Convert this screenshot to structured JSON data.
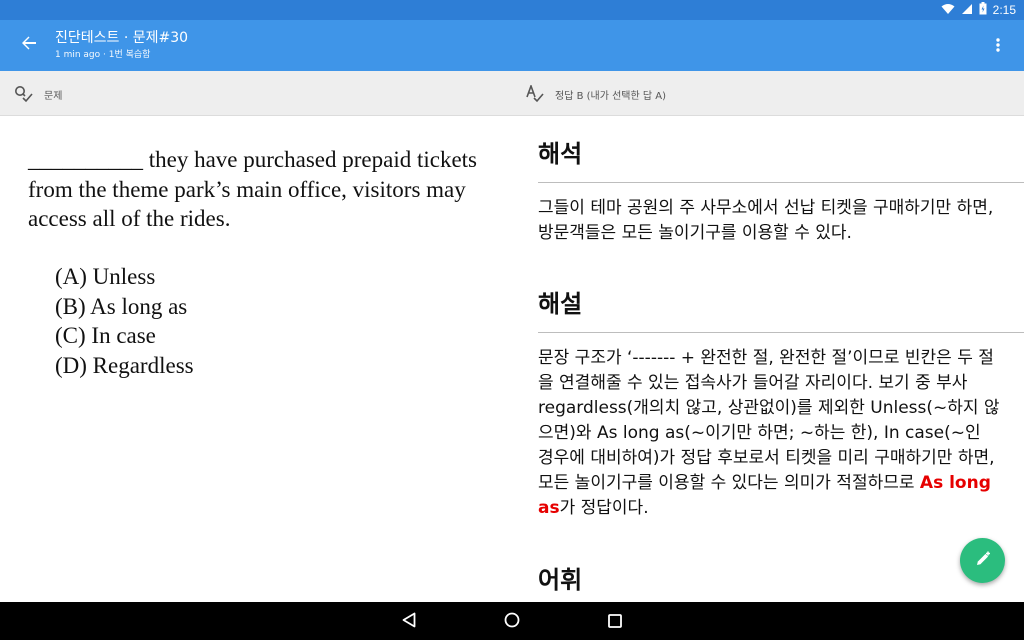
{
  "status_bar": {
    "time": "2:15",
    "icons": [
      "wifi-icon",
      "signal-icon",
      "battery-icon"
    ]
  },
  "app_bar": {
    "title": "진단테스트 · 문제#30",
    "subtitle": "1 min ago · 1번 복습함",
    "back_icon": "arrow-back-icon",
    "more_icon": "more-vert-icon"
  },
  "tabs": {
    "left_label": "문제",
    "right_label": "정답 B (내가 선택한 답 A)"
  },
  "question": {
    "stem": "__________ they have purchased prepaid tickets from the theme park’s main office, visitors may access all of the rides.",
    "options": [
      "(A) Unless",
      "(B) As long as",
      "(C) In case",
      "(D) Regardless"
    ]
  },
  "explanation": {
    "translation_title": "해석",
    "translation_body": "그들이 테마 공원의 주 사무소에서 선납 티켓을 구매하기만 하면, 방문객들은 모든 놀이기구를 이용할 수 있다.",
    "analysis_title": "해설",
    "analysis_body": "문장 구조가 ‘------- + 완전한 절, 완전한 절’이므로 빈칸은 두 절을 연결해줄 수 있는 접속사가 들어갈 자리이다. 보기 중 부사 regardless(개의치 않고, 상관없이)를 제외한 Unless(~하지 않으면)와 As long as(~이기만 하면; ~하는 한), In case(~인 경우에 대비하여)가 정답 후보로서 티켓을 미리 구매하기만 하면, 모든 놀이기구를 이용할 수 있다는 의미가 적절하므로 ",
    "answer_highlight": "As long as",
    "analysis_tail": "가 정답이다.",
    "vocab_title": "어휘"
  },
  "fab_icon": "edit-note-icon",
  "nav": [
    "back-triangle-icon",
    "home-circle-icon",
    "recents-square-icon"
  ],
  "colors": {
    "status_bar": "#2e7ed6",
    "app_bar": "#3f95e8",
    "fab": "#2bbd7e",
    "answer": "#e60000"
  }
}
